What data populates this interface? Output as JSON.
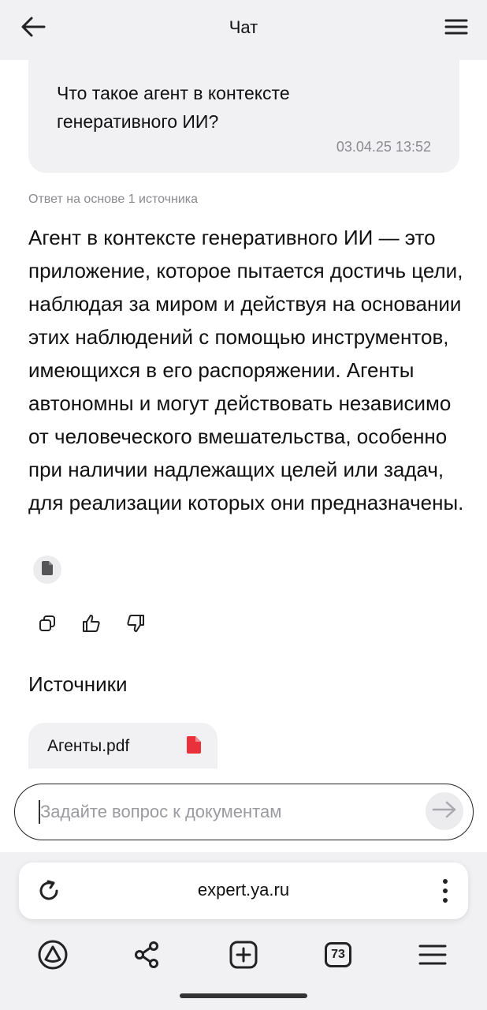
{
  "header": {
    "title": "Чат",
    "back_icon": "arrow-left-icon",
    "menu_icon": "hamburger-menu-icon"
  },
  "question": {
    "text": "Что такое агент в контексте генеративного ИИ?",
    "timestamp": "03.04.25 13:52"
  },
  "answer": {
    "source_note": "Ответ на основе 1 источника",
    "text": "Агент в контексте генеративного ИИ — это приложение, которое пытается достичь цели, наблюдая за миром и действуя на основании этих наблюдений с помощью инструментов, имеющихся в его распоряжении. Агенты автономны и могут действовать независимо от человеческого вмешательства, особенно при наличии надлежащих целей или задач, для реализации которых они предназначены."
  },
  "actions": {
    "copy_icon": "copy-icon",
    "like_icon": "thumbs-up-icon",
    "dislike_icon": "thumbs-down-icon"
  },
  "sources": {
    "title": "Источники",
    "files": [
      {
        "name": "Агенты.pdf",
        "icon": "pdf-file-icon",
        "color": "#e8313a"
      }
    ]
  },
  "input": {
    "placeholder": "Задайте вопрос к документам",
    "send_icon": "arrow-right-icon"
  },
  "browser": {
    "url": "expert.ya.ru",
    "reload_icon": "reload-icon",
    "more_icon": "more-vertical-icon",
    "nav": {
      "alice_icon": "alice-icon",
      "share_icon": "share-icon",
      "new_tab_icon": "plus-square-icon",
      "tabs_count": "73",
      "menu_icon": "hamburger-menu-icon"
    }
  }
}
